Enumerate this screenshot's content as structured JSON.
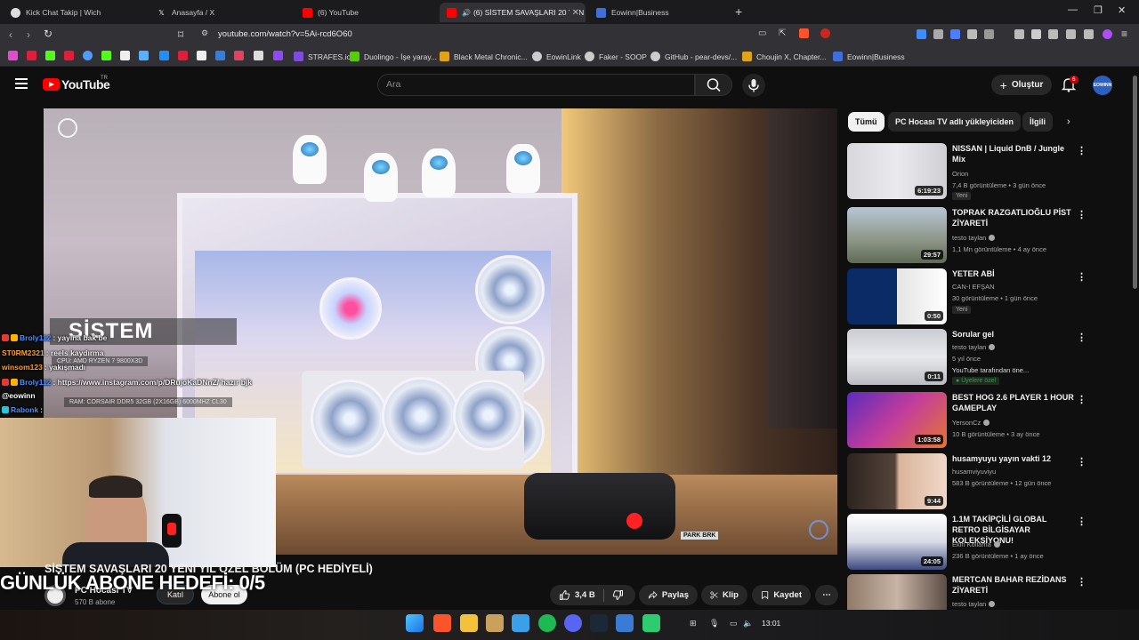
{
  "browser": {
    "tabs": [
      {
        "label": "Kick Chat Takip | Wich",
        "active": false
      },
      {
        "label": "Anasayfa / X",
        "active": false
      },
      {
        "label": "(6) YouTube",
        "active": false
      },
      {
        "label": "(6) SİSTEM SAVAŞLARI 20 YEN",
        "active": true
      },
      {
        "label": "Eowinn|Business",
        "active": false
      }
    ],
    "url": "youtube.com/watch?v=5Ai-rcd6O60",
    "bookmarks": [
      {
        "label": "STRAFES.io",
        "color": "#7d4cdb"
      },
      {
        "label": "Duolingo - İşe yaray...",
        "color": "#58cc02"
      },
      {
        "label": "Black Metal Chronic...",
        "color": "#e0a21b"
      },
      {
        "label": "EowinLink",
        "color": "#cccccc"
      },
      {
        "label": "Faker - SOOP",
        "color": "#cccccc"
      },
      {
        "label": "GitHub - pear-devs/...",
        "color": "#cccccc"
      },
      {
        "label": "Choujin X, Chapter...",
        "color": "#e0a21b"
      },
      {
        "label": "Eowinn|Business",
        "color": "#3f6fd8"
      }
    ]
  },
  "youtube": {
    "brand": "YouTube",
    "region": "TR",
    "search_placeholder": "Ara",
    "create_label": "Oluştur",
    "notification_count": "6",
    "avatar_text": "EOWINN"
  },
  "video": {
    "overlay_title": "SİSTEM",
    "spec_lines": [
      "CPU: AMD RYZEN 7 9800X3D",
      "RAM: CORSAIR DDR5 32GB (2X16GB) 6000MHZ CL30"
    ],
    "park_label": "PARK BRK",
    "chat": [
      {
        "user": "Broly112",
        "message": ": yayına bak be",
        "color": "#4c8dff"
      },
      {
        "user": "ST0RM2321",
        "message": ": reels kaydırma",
        "color": "#ff9d2b"
      },
      {
        "user": "winsom123",
        "message": ": yakışmadı",
        "color": "#ff9d2b"
      },
      {
        "user": "Broly112",
        "message": ": https://www.instagram.com/p/DRujoKaDNnZ/ hazır bjk",
        "color": "#4c8dff"
      },
      {
        "user": "@eowinn",
        "message": "",
        "color": "#ffffff"
      },
      {
        "user": "Rabonk",
        "message": ":",
        "color": "#4c8dff"
      }
    ],
    "goal_text": "GÜNLÜK ABONE HEDEFİ: 0/5"
  },
  "watch": {
    "title": "SİSTEM SAVAŞLARI 20 YENİ YIL ÖZEL BÖLÜM (PC HEDİYELİ)",
    "channel": "PC Hocası TV",
    "subscribers": "570 B abone",
    "join_label": "Katıl",
    "subscribe_label": "Abone ol",
    "likes": "3,4 B",
    "share_label": "Paylaş",
    "clip_label": "Klip",
    "save_label": "Kaydet"
  },
  "chips": [
    "Tümü",
    "PC Hocası TV adlı yükleyiciden",
    "İlgili"
  ],
  "recommendations": [
    {
      "title": "NISSAN | Liquid DnB / Jungle Mix",
      "channel": "Orion",
      "meta": "7,4 B görüntüleme • 3 gün önce",
      "duration": "6:19:23",
      "badge": "Yeni",
      "verified": false
    },
    {
      "title": "TOPRAK RAZGATLIOĞLU PİST ZİYARETİ",
      "channel": "testo taylan",
      "meta": "1,1 Mn görüntüleme • 4 ay önce",
      "duration": "29:57",
      "badge": "",
      "verified": true
    },
    {
      "title": "YETER ABİ",
      "channel": "CAN-I EFŞAN",
      "meta": "30 görüntüleme • 1 gün önce",
      "duration": "0:50",
      "badge": "Yeni",
      "verified": false
    },
    {
      "title": "Sorular gel",
      "channel": "testo taylan",
      "meta": "5 yıl önce",
      "duration": "0:11",
      "badge": "Üyelere özel",
      "extra": "YouTube tarafından öne...",
      "verified": true
    },
    {
      "title": "BEST HOG 2.6 PLAYER 1 HOUR GAMEPLAY",
      "channel": "YersonCz",
      "meta": "10 B görüntüleme • 3 ay önce",
      "duration": "1:03:58",
      "badge": "",
      "verified": true
    },
    {
      "title": "husamyuyu yayın vakti 12",
      "channel": "husamviyuviyu",
      "meta": "583 B görüntüleme • 12 gün önce",
      "duration": "9:44",
      "badge": "",
      "verified": false
    },
    {
      "title": "1.1M TAKİPÇİLİ GLOBAL RETRO BİLGİSAYAR KOLEKSİYONU!",
      "channel": "Ekin Kollama",
      "meta": "236 B görüntüleme • 1 ay önce",
      "duration": "24:05",
      "badge": "",
      "verified": true
    },
    {
      "title": "MERTCAN BAHAR REZİDANS ZİYARETİ",
      "channel": "testo taylan",
      "meta": "",
      "duration": "",
      "badge": "",
      "verified": true
    }
  ],
  "taskbar": {
    "clock": "13:01"
  }
}
